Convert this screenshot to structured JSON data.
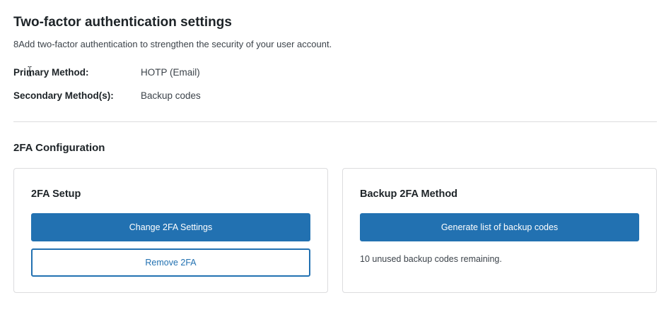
{
  "header": {
    "title": "Two-factor authentication settings",
    "description": "8Add two-factor authentication to strengthen the security of your user account."
  },
  "methods": {
    "primary": {
      "label": "Primary Method:",
      "value": "HOTP (Email)"
    },
    "secondary": {
      "label": "Secondary Method(s):",
      "value": "Backup codes"
    }
  },
  "config": {
    "title": "2FA Configuration",
    "setup_card": {
      "title": "2FA Setup",
      "change_button": "Change 2FA Settings",
      "remove_button": "Remove 2FA"
    },
    "backup_card": {
      "title": "Backup 2FA Method",
      "generate_button": "Generate list of backup codes",
      "remaining_text": "10 unused backup codes remaining."
    }
  },
  "colors": {
    "accent": "#2271b1",
    "border": "#dcdcde",
    "text": "#1d2327"
  },
  "icons": {
    "cursor": "text-cursor-icon"
  }
}
